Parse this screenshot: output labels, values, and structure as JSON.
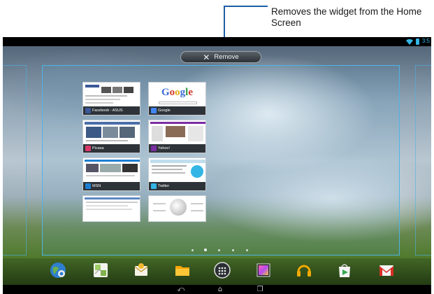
{
  "callout": {
    "text": "Removes the widget from the Home Screen"
  },
  "status_bar": {
    "clock": "3:5"
  },
  "remove_button": {
    "label": "Remove",
    "icon": "close-icon"
  },
  "widget": {
    "bookmarks": [
      {
        "label": "Facebook - ASUS",
        "fav_color": "#3b5998"
      },
      {
        "label": "Google",
        "fav_color": "#4285f4"
      },
      {
        "label": "Picasa",
        "fav_color": "#d93a6b"
      },
      {
        "label": "Yahoo!",
        "fav_color": "#7b2da3"
      },
      {
        "label": "MSN",
        "fav_color": "#1d7fd1"
      },
      {
        "label": "Twitter",
        "fav_color": "#33b5e5"
      },
      {
        "label": "",
        "fav_color": "#5b88c4"
      },
      {
        "label": "",
        "fav_color": "#999999"
      }
    ],
    "google_logo": [
      "G",
      "o",
      "o",
      "g",
      "l",
      "e"
    ]
  },
  "dock": {
    "apps": [
      {
        "name": "browser-globe-icon"
      },
      {
        "name": "gallery-map-icon"
      },
      {
        "name": "email-icon"
      },
      {
        "name": "file-manager-icon"
      },
      {
        "name": "all-apps-icon"
      },
      {
        "name": "photo-editor-icon"
      },
      {
        "name": "music-headphones-icon"
      },
      {
        "name": "play-store-icon"
      },
      {
        "name": "gmail-icon"
      }
    ]
  },
  "nav_bar": {
    "back": "back-icon",
    "home": "home-icon",
    "recents": "recent-apps-icon"
  },
  "colors": {
    "accent": "#33b5e5",
    "frame": "#4fb3e6",
    "callout_line": "#1b5fa6"
  }
}
